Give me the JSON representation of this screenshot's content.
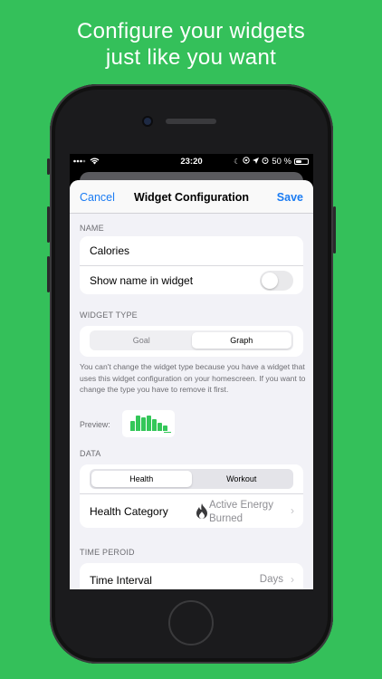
{
  "promo": {
    "line1": "Configure your widgets",
    "line2": "just like you want"
  },
  "status_bar": {
    "time": "23:20",
    "battery": "50 %",
    "battery_level": 0.5
  },
  "nav": {
    "cancel_label": "Cancel",
    "title": "Widget Configuration",
    "save_label": "Save"
  },
  "name_section": {
    "header": "NAME",
    "name_value": "Calories",
    "show_name_label": "Show name in widget",
    "show_name_enabled": false
  },
  "widget_type_section": {
    "header": "WIDGET TYPE",
    "options": [
      "Goal",
      "Graph"
    ],
    "selected": "Graph",
    "note": "You can't change the widget type because you have a widget that uses this widget configuration on your homescreen. If you want to change the type you have to remove it first.",
    "preview_label": "Preview:",
    "preview_bars": [
      0.6,
      0.95,
      0.85,
      0.95,
      0.7,
      0.5,
      0.35
    ],
    "accent_color": "#34c759"
  },
  "data_section": {
    "header": "DATA",
    "options": [
      "Health",
      "Workout"
    ],
    "selected": "Health",
    "category_label": "Health Category",
    "category_icon": "flame-icon",
    "category_value_line1": "Active Energy",
    "category_value_line2": "Burned"
  },
  "time_section": {
    "header": "TIME PEROID",
    "interval_label": "Time Interval",
    "interval_value": "Days"
  },
  "colors": {
    "background": "#34c05a",
    "link": "#1b7cf3",
    "toggle_off": "#e9e9eb"
  }
}
